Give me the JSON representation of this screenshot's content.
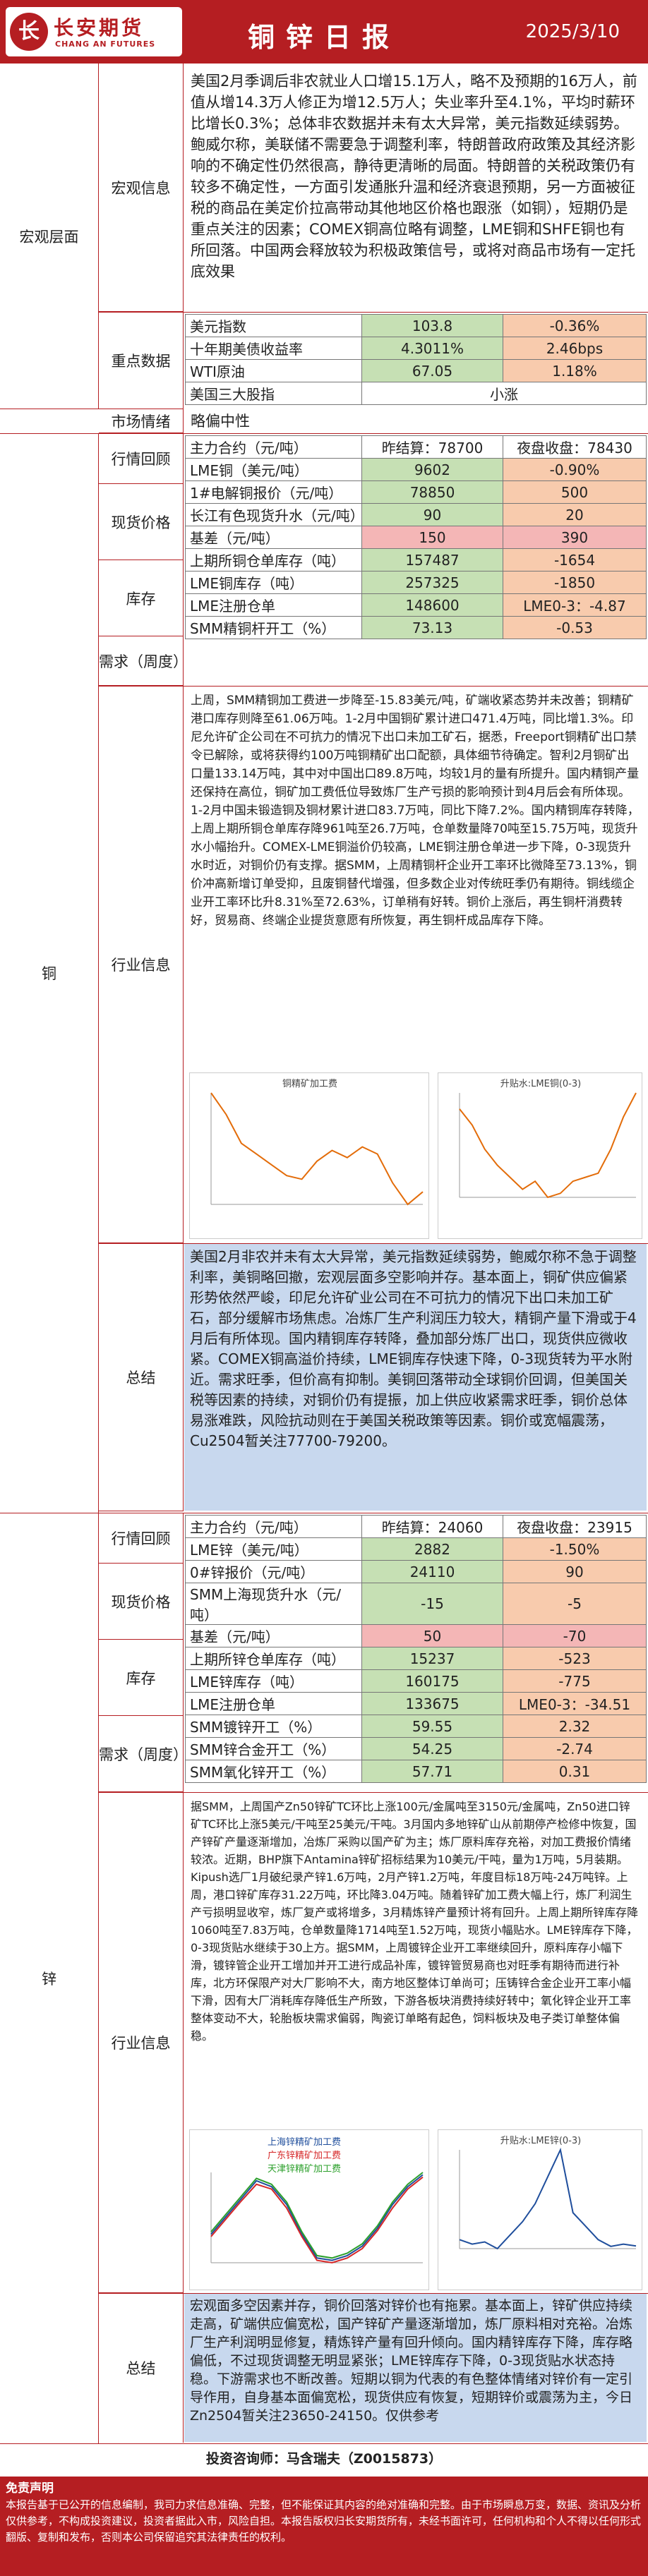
{
  "header": {
    "logo_mark": "长",
    "company_cn": "长安期货",
    "company_en": "CHANG AN FUTURES",
    "title": "铜锌日报",
    "date": "2025/3/10"
  },
  "macro": {
    "section_label": "宏观层面",
    "info_label": "宏观信息",
    "info_text": "美国2月季调后非农就业人口增15.1万人，略不及预期的16万人，前值从增14.3万人修正为增12.5万人；失业率升至4.1%，平均时薪环比增长0.3%；总体非农数据并未有太大异常，美元指数延续弱势。鲍威尔称，美联储不需要急于调整利率，特朗普政府政策及其经济影响的不确定性仍然很高，静待更清晰的局面。特朗普的关税政策仍有较多不确定性，一方面引发通胀升温和经济衰退预期，另一方面被征税的商品在美定价拉高带动其他地区价格也跟涨（如铜），短期仍是重点关注的因素；COMEX铜高位略有调整，LME铜和SHFE铜也有所回落。中国两会释放较为积极政策信号，或将对商品市场有一定托底效果",
    "key_label": "重点数据",
    "key_rows": [
      {
        "name": "美元指数",
        "value": "103.8",
        "change": "-0.36%"
      },
      {
        "name": "十年期美债收益率",
        "value": "4.3011%",
        "change": "2.46bps"
      },
      {
        "name": "WTI原油",
        "value": "67.05",
        "change": "1.18%"
      },
      {
        "name": "美国三大股指",
        "value": "",
        "change": "小涨"
      }
    ],
    "sentiment_label": "市场情绪",
    "sentiment_value": "略偏中性"
  },
  "copper": {
    "section_label": "铜",
    "quote_label": "行情回顾",
    "spot_label": "现货价格",
    "stock_label": "库存",
    "demand_label": "需求（周度）",
    "industry_label": "行业信息",
    "summary_label": "总结",
    "col_close": "昨结算：78700",
    "col_night": "夜盘收盘：78430",
    "rows": [
      {
        "name": "主力合约（元/吨）",
        "value": "昨结算：78700",
        "change": "夜盘收盘：78430"
      },
      {
        "name": "LME铜（美元/吨）",
        "value": "9602",
        "change": "-0.90%"
      },
      {
        "name": "1#电解铜报价（元/吨）",
        "value": "78850",
        "change": "500"
      },
      {
        "name": "长江有色现货升水（元/吨）",
        "value": "90",
        "change": "20"
      },
      {
        "name": "基差（元/吨）",
        "value": "150",
        "change": "390"
      },
      {
        "name": "上期所铜仓单库存（吨）",
        "value": "157487",
        "change": "-1654"
      },
      {
        "name": "LME铜库存（吨）",
        "value": "257325",
        "change": "-1850"
      },
      {
        "name": "LME注册仓单",
        "value": "148600",
        "change": "LME0-3：-4.87"
      },
      {
        "name": "SMM精铜杆开工（%）",
        "value": "73.13",
        "change": "-0.53"
      }
    ],
    "commentary": "上周，SMM精铜加工费进一步降至-15.83美元/吨，矿端收紧态势并未改善；铜精矿港口库存则降至61.06万吨。1-2月中国铜矿累计进口471.4万吨，同比增1.3%。印尼允许矿企公司在不可抗力的情况下出口未加工矿石，据悉，Freeport铜精矿出口禁令已解除，或将获得约100万吨铜精矿出口配额，具体细节待确定。智利2月铜矿出口量133.14万吨，其中对中国出口89.8万吨，均较1月的量有所提升。国内精铜产量还保持在高位，铜矿加工费低位导致炼厂生产亏损的影响预计到4月后会有所体现。1-2月中国未锻造铜及铜材累计进口83.7万吨，同比下降7.2%。国内精铜库存转降，上周上期所铜仓单库存降961吨至26.7万吨，仓单数量降70吨至15.75万吨，现货升水小幅抬升。COMEX-LME铜溢价仍较高，LME铜注册仓单进一步下降，0-3现货升水时近，对铜价仍有支撑。据SMM，上周精铜杆企业开工率环比微降至73.13%，铜价冲高新增订单受抑，且废铜替代增强，但多数企业对传统旺季仍有期待。铜线缆企业开工率环比升8.31%至72.63%，订单稍有好转。铜价上涨后，再生铜杆消费转好，贸易商、终端企业提货意愿有所恢复，再生铜杆成品库存下降。",
    "summary": "美国2月非农并未有太大异常，美元指数延续弱势，鲍威尔称不急于调整利率，美铜略回撤，宏观层面多空影响并存。基本面上，铜矿供应偏紧形势依然严峻，印尼允许矿业公司在不可抗力的情况下出口未加工矿石，部分缓解市场焦虑。冶炼厂生产利润压力较大，精铜产量下滑或于4月后有所体现。国内精铜库存转降，叠加部分炼厂出口，现货供应微收紧。COMEX铜高溢价持续，LME铜库存快速下降，0-3现货转为平水附近。需求旺季，但价高有抑制。美铜回落带动全球铜价回调，但美国关税等因素的持续，对铜价仍有提振，加上供应收紧需求旺季，铜价总体易涨难跌，风险抗动则在于美国关税政策等因素。铜价或宽幅震荡，Cu2504暂关注77700-79200。",
    "chart1": {
      "type": "line",
      "title": "铜精矿加工费",
      "series": [
        {
          "name": "",
          "values": [
            40,
            28,
            12,
            6,
            0,
            -6,
            -8,
            2,
            8,
            4,
            10,
            6,
            -10,
            -22,
            -15
          ]
        }
      ]
    },
    "chart2": {
      "type": "line",
      "title": "升贴水:LME铜(0-3)",
      "series": [
        {
          "name": "",
          "values": [
            -10,
            -30,
            -60,
            -80,
            -95,
            -110,
            -100,
            -120,
            -115,
            -100,
            -95,
            -90,
            -60,
            -20,
            10
          ]
        }
      ]
    }
  },
  "zinc": {
    "section_label": "锌",
    "quote_label": "行情回顾",
    "spot_label": "现货价格",
    "stock_label": "库存",
    "demand_label": "需求（周度）",
    "industry_label": "行业信息",
    "summary_label": "总结",
    "rows": [
      {
        "name": "主力合约（元/吨）",
        "value": "昨结算：24060",
        "change": "夜盘收盘：23915"
      },
      {
        "name": "LME锌（美元/吨）",
        "value": "2882",
        "change": "-1.50%"
      },
      {
        "name": "0#锌报价（元/吨）",
        "value": "24110",
        "change": "90"
      },
      {
        "name": "SMM上海现货升水（元/吨）",
        "value": "-15",
        "change": "-5"
      },
      {
        "name": "基差（元/吨）",
        "value": "50",
        "change": "-70"
      },
      {
        "name": "上期所锌仓单库存（吨）",
        "value": "15237",
        "change": "-523"
      },
      {
        "name": "LME锌库存（吨）",
        "value": "160175",
        "change": "-775"
      },
      {
        "name": "LME注册仓单",
        "value": "133675",
        "change": "LME0-3：-34.51"
      },
      {
        "name": "SMM镀锌开工（%）",
        "value": "59.55",
        "change": "2.32"
      },
      {
        "name": "SMM锌合金开工（%）",
        "value": "54.25",
        "change": "-2.74"
      },
      {
        "name": "SMM氧化锌开工（%）",
        "value": "57.71",
        "change": "0.31"
      }
    ],
    "commentary": "据SMM，上周国产Zn50锌矿TC环比上涨100元/金属吨至3150元/金属吨，Zn50进口锌矿TC环比上涨5美元/干吨至25美元/干吨。3月国内多地锌矿山从前期停产检修中恢复，国产锌矿产量逐渐增加，冶炼厂采购以国产矿为主；炼厂原料库存充裕，对加工费报价情绪较浓。近期，BHP旗下Antamina锌矿招标结果为10美元/干吨，量为1万吨，5月装期。Kipush选厂1月破纪录产锌1.6万吨，2月产锌1.2万吨，年度目标18万吨-24万吨锌。上周，港口锌矿库存31.22万吨，环比降3.04万吨。随着锌矿加工费大幅上行，炼厂利润生产亏损明显收窄，炼厂复产或将增多，3月精炼锌产量预计将有回升。上周上期所锌库存降1060吨至7.83万吨，仓单数量降1714吨至1.52万吨，现货小幅贴水。LME锌库存下降，0-3现货贴水继续于30上方。据SMM，上周镀锌企业开工率继续回升，原料库存小幅下滑，镀锌管企业开工增加并开工进行成品补库，镀锌管贸易商也对旺季有期待而进行补库，北方环保限产对大厂影响不大，南方地区整体订单尚可；压铸锌合金企业开工率小幅下滑，因有大厂消耗库存降低生产所致，下游各板块消费持续好转中；氧化锌企业开工率整体变动不大，轮胎板块需求偏弱，陶瓷订单略有起色，饲料板块及电子类订单整体偏稳。",
    "summary": "宏观面多空因素并存，铜价回落对锌价也有拖累。基本面上，锌矿供应持续走高，矿端供应偏宽松，国产锌矿产量逐渐增加，炼厂原料相对充裕。冶炼厂生产利润明显修复，精炼锌产量有回升倾向。国内精锌库存下降，库存略偏低，不过现货调整无明显紧张；LME锌库存下降，0-3现货贴水状态持稳。下游需求也不断改善。短期以铜为代表的有色整体情绪对锌价有一定引导作用，自身基本面偏宽松，现货供应有恢复，短期锌价或震荡为主，今日Zn2504暂关注23650-24150。仅供参考",
    "chart1": {
      "type": "line",
      "title": "",
      "legend": [
        "上海锌精矿加工费",
        "广东锌精矿加工费",
        "天津锌精矿加工费"
      ],
      "series": [
        {
          "name": "上海锌精矿加工费",
          "values": [
            30,
            45,
            60,
            75,
            70,
            55,
            30,
            10,
            8,
            12,
            20,
            35,
            55,
            70,
            80
          ]
        },
        {
          "name": "广东锌精矿加工费",
          "values": [
            28,
            43,
            58,
            72,
            68,
            52,
            28,
            8,
            6,
            10,
            18,
            33,
            52,
            68,
            78
          ]
        },
        {
          "name": "天津锌精矿加工费",
          "values": [
            32,
            47,
            62,
            77,
            72,
            57,
            32,
            12,
            10,
            14,
            22,
            37,
            57,
            72,
            82
          ]
        }
      ]
    },
    "chart2": {
      "type": "line",
      "title": "升贴水:LME锌(0-3)",
      "series": [
        {
          "name": "",
          "values": [
            -20,
            -30,
            -25,
            -40,
            -10,
            20,
            60,
            120,
            180,
            40,
            10,
            -20,
            -35,
            -30,
            -34
          ]
        }
      ]
    }
  },
  "footer": {
    "signature": "投资咨询师：马含瑞夫（Z0015873）",
    "disclaimer_title": "免责声明",
    "disclaimer": "本报告基于已公开的信息编制，我司力求信息准确、完整，但不能保证其内容的绝对准确和完整。由于市场瞬息万变，数据、资讯及分析仅供参考，不构成投资建议，投资者据此入市，风险自担。本报告版权归长安期货所有，未经书面许可，任何机构和个人不得以任何形式翻版、复制和发布，否则本公司保留追究其法律责任的权利。"
  },
  "colors": {
    "brand_red": "#b51e22",
    "value_green": "#c6e0b4",
    "change_orange": "#f8cbad",
    "summary_blue": "#c8d8ee"
  }
}
